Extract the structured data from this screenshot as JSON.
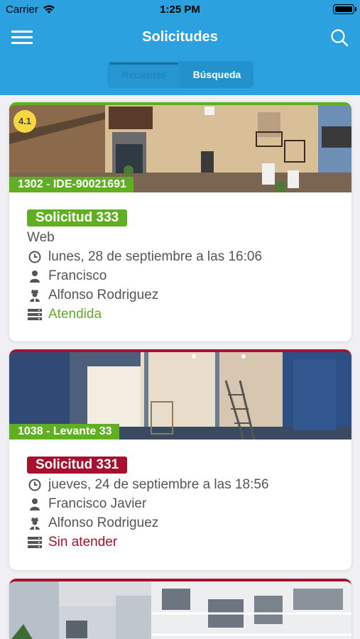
{
  "status_bar": {
    "carrier": "Carrier",
    "time": "1:25 PM",
    "wifi_icon": "wifi-icon",
    "battery_icon": "battery-icon"
  },
  "navbar": {
    "title": "Solicitudes",
    "menu_icon": "hamburger-icon",
    "search_icon": "search-icon"
  },
  "tabs": [
    {
      "label": "Recientes",
      "active": true
    },
    {
      "label": "Búsqueda",
      "active": false
    }
  ],
  "colors": {
    "accent": "#2ba1e0",
    "attended": "#5faf22",
    "pending": "#a8102d"
  },
  "requests": [
    {
      "property_code": "1302 - IDE-90021691",
      "rating": "4.1",
      "title": "Solicitud 333",
      "channel": "Web",
      "date": "lunes, 28 de septiembre a las 16:06",
      "user": "Francisco",
      "agent": "Alfonso Rodriguez",
      "status": "Atendida",
      "status_color": "#5faf22"
    },
    {
      "property_code": "1038 - Levante 33",
      "title": "Solicitud 331",
      "date": "jueves, 24 de septiembre a las 18:56",
      "user": "Francisco Javier",
      "agent": "Alfonso Rodriguez",
      "status": "Sin atender",
      "status_color": "#a8102d"
    }
  ]
}
